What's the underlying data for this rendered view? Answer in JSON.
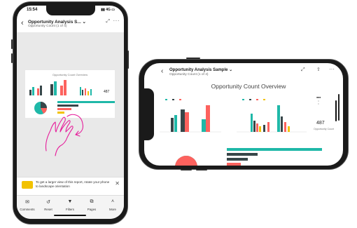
{
  "portrait": {
    "status": {
      "time": "15:54",
      "signal": "4G"
    },
    "header": {
      "title": "Opportunity Analysis S...",
      "title_suffix": "⌄",
      "subtitle": "Opportunity Count (1 of 4)",
      "expand_icon": "expand-icon",
      "more_icon": "more-icon"
    },
    "report": {
      "title": "Opportunity Count Overview",
      "kpi": "487"
    },
    "rotate_banner": {
      "text": "To get a larger view of this report, rotate your phone to landscape orientation",
      "close_icon": "close-icon"
    },
    "toolbar": [
      {
        "label": "Comments",
        "icon": "comment-icon",
        "glyph": "✉"
      },
      {
        "label": "Reset",
        "icon": "reset-icon",
        "glyph": "↺"
      },
      {
        "label": "Filters",
        "icon": "filter-icon",
        "glyph": "▼"
      },
      {
        "label": "Pages",
        "icon": "pages-icon",
        "glyph": "⧉"
      },
      {
        "label": "More",
        "icon": "chevron-up-icon",
        "glyph": "˄"
      }
    ]
  },
  "landscape": {
    "header": {
      "title": "Opportunity Analysis Sample",
      "title_suffix": "⌄",
      "subtitle": "Opportunity Count (1 of 4)",
      "expand_icon": "expand-icon",
      "share_icon": "share-icon",
      "more_icon": "more-icon"
    },
    "report": {
      "title": "Opportunity Count Overview",
      "kpi": "487",
      "kpi_label": "Opportunity Count"
    }
  },
  "colors": {
    "teal": "#1fb8a8",
    "dark": "#374649",
    "red": "#fd625e",
    "yellow": "#f2c200",
    "gray": "#8ad4eb",
    "annotation": "#e61e9b"
  }
}
